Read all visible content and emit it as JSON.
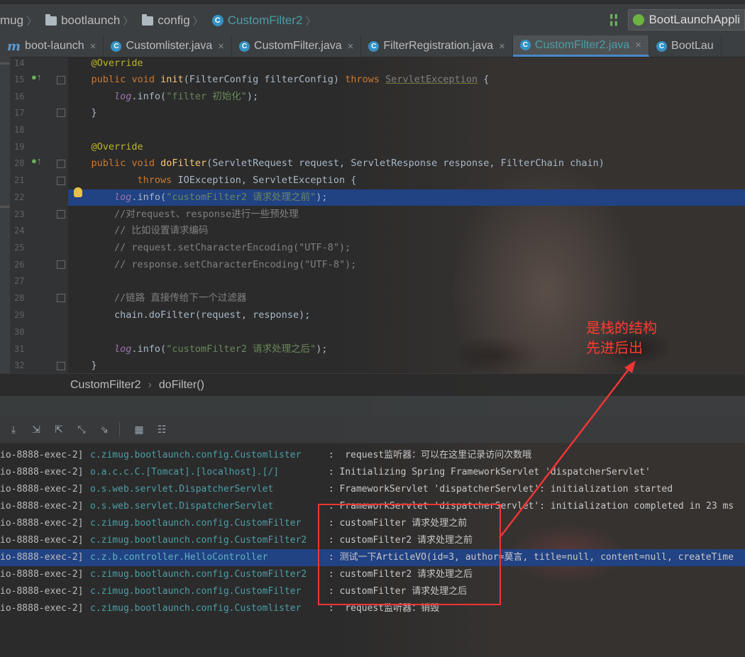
{
  "breadcrumb": [
    "mug",
    "bootlaunch",
    "config",
    "CustomFilter2"
  ],
  "run_config": "BootLaunchAppli",
  "tabs": [
    {
      "label": "boot-launch",
      "icon": "m"
    },
    {
      "label": "Customlister.java",
      "icon": "C"
    },
    {
      "label": "CustomFilter.java",
      "icon": "C"
    },
    {
      "label": "FilterRegistration.java",
      "icon": "C"
    },
    {
      "label": "CustomFilter2.java",
      "icon": "C"
    },
    {
      "label": "BootLau",
      "icon": "C"
    }
  ],
  "editor": {
    "line_numbers": [
      "14",
      "15",
      "16",
      "17",
      "18",
      "19",
      "20",
      "21",
      "22",
      "23",
      "24",
      "25",
      "26",
      "27",
      "28",
      "29",
      "30",
      "31",
      "32"
    ],
    "tokens": {
      "override": "@Override",
      "public": "public",
      "void": "void",
      "init": "init",
      "init_params": "(FilterConfig filterConfig) ",
      "throws": "throws",
      "servlet_exception": "ServletException",
      "open_brace": " {",
      "close_brace": "}",
      "log": "log",
      "info": ".info(",
      "str_init": "\"filter 初始化\"",
      "end_stmt": ");",
      "dofilter": "doFilter",
      "dofilter_params": "(ServletRequest request, ServletResponse response, FilterChain chain)",
      "ioexception": " IOException, ServletException {",
      "str_before": "\"customFilter2 请求处理之前\"",
      "c23": "//对request、response进行一些预处理",
      "c24": "// 比如设置请求编码",
      "c25": "// request.setCharacterEncoding(\"UTF-8\");",
      "c26": "// response.setCharacterEncoding(\"UTF-8\");",
      "c28": "//链路 直接传给下一个过滤器",
      "chain_call": "chain.doFilter(request, response);",
      "str_after": "\"customFilter2 请求处理之后\""
    }
  },
  "editor_breadcrumb": [
    "CustomFilter2",
    "doFilter()"
  ],
  "console": [
    {
      "thread": "io-8888-exec-2]",
      "logger": "c.zimug.bootlaunch.config.Customlister",
      "msg": " :  request监听器：可以在这里记录访问次数哦"
    },
    {
      "thread": "io-8888-exec-2]",
      "logger": "o.a.c.c.C.[Tomcat].[localhost].[/]",
      "msg": " : Initializing Spring FrameworkServlet 'dispatcherServlet'"
    },
    {
      "thread": "io-8888-exec-2]",
      "logger": "o.s.web.servlet.DispatcherServlet",
      "msg": " : FrameworkServlet 'dispatcherServlet': initialization started"
    },
    {
      "thread": "io-8888-exec-2]",
      "logger": "o.s.web.servlet.DispatcherServlet",
      "msg": " : FrameworkServlet 'dispatcherServlet': initialization completed in 23 ms"
    },
    {
      "thread": "io-8888-exec-2]",
      "logger": "c.zimug.bootlaunch.config.CustomFilter",
      "msg": " : customFilter 请求处理之前"
    },
    {
      "thread": "io-8888-exec-2]",
      "logger": "c.zimug.bootlaunch.config.CustomFilter2",
      "msg": " : customFilter2 请求处理之前"
    },
    {
      "thread": "io-8888-exec-2]",
      "logger": "c.z.b.controller.HelloController",
      "msg": " : 测试一下ArticleVO(id=3, author=莫言, title=null, content=null, createTime"
    },
    {
      "thread": "io-8888-exec-2]",
      "logger": "c.zimug.bootlaunch.config.CustomFilter2",
      "msg": " : customFilter2 请求处理之后"
    },
    {
      "thread": "io-8888-exec-2]",
      "logger": "c.zimug.bootlaunch.config.CustomFilter",
      "msg": " : customFilter 请求处理之后"
    },
    {
      "thread": "io-8888-exec-2]",
      "logger": "c.zimug.bootlaunch.config.Customlister",
      "msg": " :  request监听器：销毁"
    }
  ],
  "annotation": {
    "line1": "是栈的结构",
    "line2": "先进后出",
    "color": "#ff3b30"
  },
  "colors": {
    "keyword": "#cc7832",
    "string": "#6a8759",
    "comment": "#808080",
    "highlight": "#214283",
    "link": "#4c9ea6"
  }
}
